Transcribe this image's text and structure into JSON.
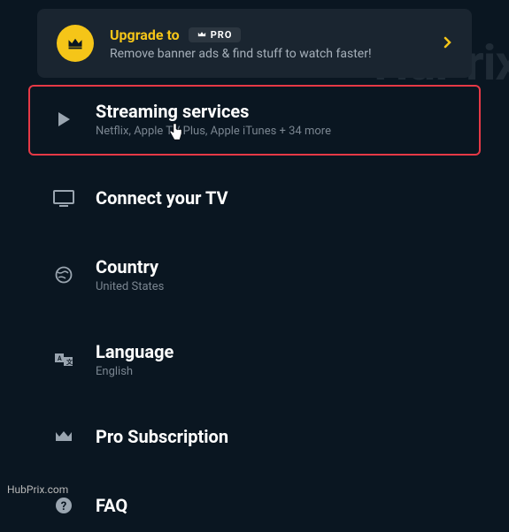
{
  "watermark": "HuPrix",
  "banner": {
    "title": "Upgrade to",
    "badge": "PRO",
    "subtitle": "Remove banner ads & find stuff to watch faster!"
  },
  "items": {
    "streaming": {
      "title": "Streaming services",
      "sub": "Netflix, Apple TV Plus, Apple iTunes + 34 more"
    },
    "tv": {
      "title": "Connect your TV"
    },
    "country": {
      "title": "Country",
      "sub": "United States"
    },
    "language": {
      "title": "Language",
      "sub": "English"
    },
    "pro": {
      "title": "Pro Subscription"
    },
    "faq": {
      "title": "FAQ"
    }
  },
  "attribution": "HubPrix.com"
}
